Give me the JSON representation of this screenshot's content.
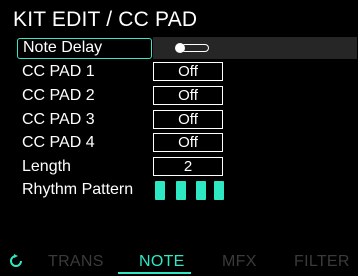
{
  "header": {
    "title": "KIT EDIT / CC PAD"
  },
  "params": [
    {
      "label": "Note Delay",
      "type": "toggle",
      "value": "on"
    },
    {
      "label": "CC PAD 1",
      "value": "Off"
    },
    {
      "label": "CC PAD 2",
      "value": "Off"
    },
    {
      "label": "CC PAD 3",
      "value": "Off"
    },
    {
      "label": "CC PAD 4",
      "value": "Off"
    },
    {
      "label": "Length",
      "value": "2"
    },
    {
      "label": "Rhythm Pattern",
      "type": "steps",
      "steps": 4
    }
  ],
  "tabs": [
    {
      "label": "TRANS",
      "active": false
    },
    {
      "label": "NOTE",
      "active": true
    },
    {
      "label": "MFX",
      "active": false
    },
    {
      "label": "FILTER",
      "active": false
    }
  ],
  "icons": {
    "tab_prefix": "refresh-icon",
    "toggle": "toggle-switch-icon"
  },
  "colors": {
    "accent": "#2ee8c4",
    "background": "#000000",
    "inactive_tab": "#3a3a3a"
  }
}
